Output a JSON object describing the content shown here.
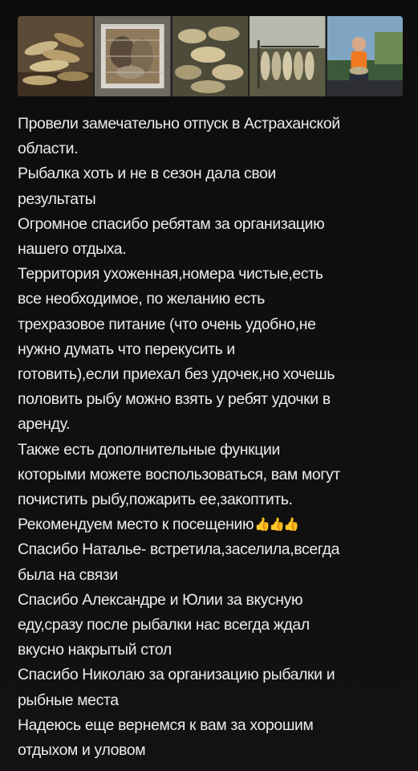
{
  "photos": [
    {
      "icon": "photo-fish-pile-on-table"
    },
    {
      "icon": "photo-fish-in-crate"
    },
    {
      "icon": "photo-fish-on-tarp"
    },
    {
      "icon": "photo-fish-catch-outdoors"
    },
    {
      "icon": "photo-person-holding-fish"
    }
  ],
  "review": {
    "lines": [
      "Провели замечательно отпуск в Астраханской",
      "области.",
      "Рыбалка хоть и не в сезон дала свои",
      "результаты",
      "Огромное спасибо ребятам за организацию",
      "нашего отдыха.",
      "Территория ухоженная,номера чистые,есть",
      "все необходимое, по желанию есть",
      "трехразовое питание (что очень удобно,не",
      "нужно думать что перекусить и",
      "готовить),если приехал без удочек,но хочешь",
      "половить рыбу можно взять у ребят удочки в",
      "аренду.",
      "Также есть дополнительные функции",
      "которыми можете воспользоваться, вам могут",
      "почистить рыбу,пожарить ее,закоптить.",
      "Рекомендуем место к посещению",
      "Спасибо Наталье- встретила,заселила,всегда",
      "была на связи",
      "Спасибо Александре и Юлии за вкусную",
      "еду,сразу после рыбалки нас всегда ждал",
      "вкусно накрытый стол",
      "Спасибо Николаю за организацию рыбалки и",
      "рыбные места",
      "Надеюсь еще вернемся к вам за хорошим",
      "отдыхом и уловом"
    ],
    "emoji": "👍👍👍",
    "emoji_icon": "thumbs-up-icon"
  },
  "colors": {
    "background": "#0f0f0f",
    "text": "#ececec",
    "emoji": "#f5b800"
  }
}
